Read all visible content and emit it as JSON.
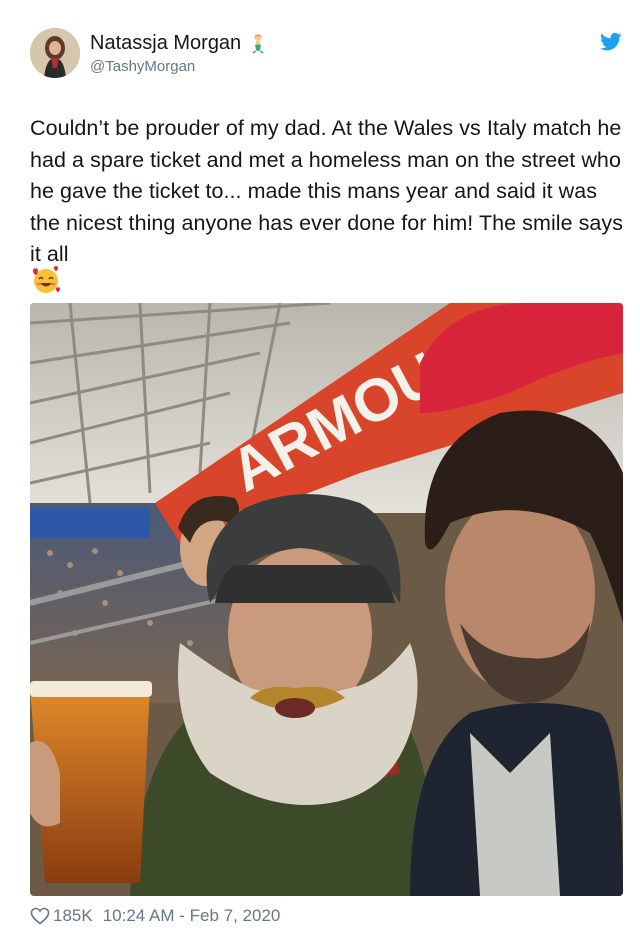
{
  "user": {
    "name": "Natassja Morgan",
    "handle": "@TashyMorgan",
    "name_emoji": "mermaid-emoji"
  },
  "tweet": {
    "text": "Couldn’t be prouder of my dad. At the Wales vs Italy match he had a spare ticket and met a homeless man on the street who he gave the ticket to... made this mans year and said it was the nicest thing anyone has ever done for him! The smile says it all",
    "emoji": "smiling-face-with-hearts-emoji",
    "photo_sign_text": "ARMOU"
  },
  "footer": {
    "likes": "185K",
    "timestamp": "10:24 AM - Feb 7, 2020"
  },
  "colors": {
    "twitter_blue": "#1da1f2",
    "secondary_text": "#657786",
    "banner_red": "#d9452b"
  },
  "icons": {
    "brand": "twitter-bird-icon",
    "like": "heart-outline-icon"
  }
}
